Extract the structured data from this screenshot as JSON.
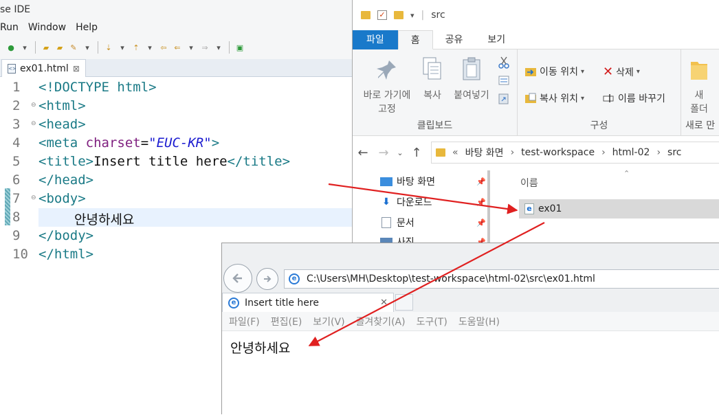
{
  "eclipse": {
    "title": "se IDE",
    "menu": [
      "Run",
      "Window",
      "Help"
    ],
    "tab_label": "ex01.html",
    "tab_close": "⊠",
    "lines": [
      {
        "num": "1",
        "fold": ""
      },
      {
        "num": "2",
        "fold": "⊖"
      },
      {
        "num": "3",
        "fold": "⊖"
      },
      {
        "num": "4",
        "fold": ""
      },
      {
        "num": "5",
        "fold": ""
      },
      {
        "num": "6",
        "fold": ""
      },
      {
        "num": "7",
        "fold": "⊖"
      },
      {
        "num": "8",
        "fold": ""
      },
      {
        "num": "9",
        "fold": ""
      },
      {
        "num": "10",
        "fold": ""
      }
    ],
    "code": {
      "l1": "<!DOCTYPE html>",
      "l2": "<html>",
      "l3": "<head>",
      "l4_open": "<meta ",
      "l4_attr": "charset",
      "l4_eq": "=",
      "l4_val": "\"EUC-KR\"",
      "l4_close": ">",
      "l5_open": "<title>",
      "l5_text": "Insert title here",
      "l5_close": "</title>",
      "l6": "</head>",
      "l7": "<body>",
      "l8_text": "안녕하세요",
      "l9": "</body>",
      "l10": "</html>"
    }
  },
  "explorer": {
    "window_title": "src",
    "tabs": {
      "file": "파일",
      "home": "홈",
      "share": "공유",
      "view": "보기"
    },
    "clipboard": {
      "pin_label_1": "바로 가기에",
      "pin_label_2": "고정",
      "copy": "복사",
      "paste": "붙여넣기",
      "group": "클립보드"
    },
    "organize": {
      "move_to": "이동 위치",
      "copy_to": "복사 위치",
      "delete": "삭제",
      "rename": "이름 바꾸기",
      "group": "구성"
    },
    "new": {
      "folder_1": "새",
      "folder_2": "폴더",
      "group": "새로 만"
    },
    "breadcrumb": {
      "chev": "«",
      "parts": [
        "바탕 화면",
        "test-workspace",
        "html-02",
        "src"
      ],
      "sep": "›"
    },
    "nav_items": [
      "바탕 화면",
      "다운로드",
      "문서",
      "사진"
    ],
    "column_header": "이름",
    "file_name": "ex01"
  },
  "browser": {
    "address": "C:\\Users\\MH\\Desktop\\test-workspace\\html-02\\src\\ex01.html",
    "tab_title": "Insert title here",
    "tab_close": "✕",
    "menu": [
      "파일(F)",
      "편집(E)",
      "보기(V)",
      "즐겨찾기(A)",
      "도구(T)",
      "도움말(H)"
    ],
    "content_text": "안녕하세요"
  },
  "colors": {
    "annotation_arrow": "#e02020",
    "explorer_file_tab": "#1979ca",
    "html_tag": "#1a7a86",
    "html_attr": "#7f1f7f",
    "html_attr_value": "#1a1ad0"
  },
  "icons": [
    "fileicon",
    "folder-icon",
    "pin-icon",
    "copy-icon",
    "paste-icon",
    "scissors-icon",
    "delete-icon",
    "rename-icon",
    "ie-logo",
    "back-arrow-icon",
    "forward-arrow-icon",
    "up-arrow-icon"
  ]
}
